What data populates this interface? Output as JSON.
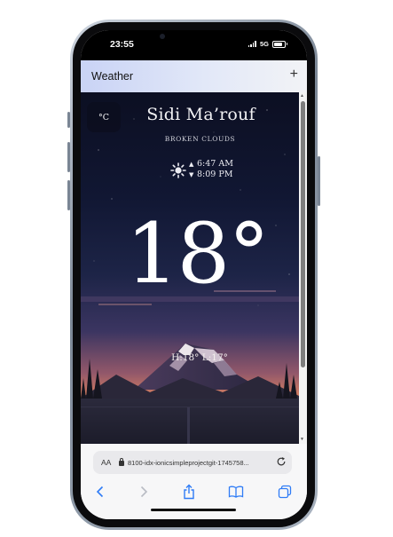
{
  "status_bar": {
    "time": "23:55",
    "network": "5G"
  },
  "app": {
    "title": "Weather",
    "add_symbol": "+"
  },
  "weather": {
    "unit_toggle": "°C",
    "city": "Sidi Ma’rouf",
    "condition": "BROKEN CLOUDS",
    "sunrise": "6:47 AM",
    "sunset": "8:09 PM",
    "temperature": "18°",
    "hi_lo": "H:18° L:17°"
  },
  "browser": {
    "text_size_label": "AA",
    "url": "8100-idx-ionicsimpleprojectgit-1745758..."
  },
  "icons": {
    "sun": "sun-icon",
    "sunrise": "arrow-up-icon",
    "sunset": "arrow-down-icon",
    "lock": "lock-icon",
    "reload": "reload-icon",
    "back": "chevron-left-icon",
    "forward": "chevron-right-icon",
    "share": "share-icon",
    "bookmarks": "book-icon",
    "tabs": "tabs-icon"
  },
  "colors": {
    "header_gradient_start": "#c9d3f5",
    "browser_accent": "#2f7cf6",
    "night_sky": "#111733",
    "sunset_glow": "#d07c62"
  }
}
